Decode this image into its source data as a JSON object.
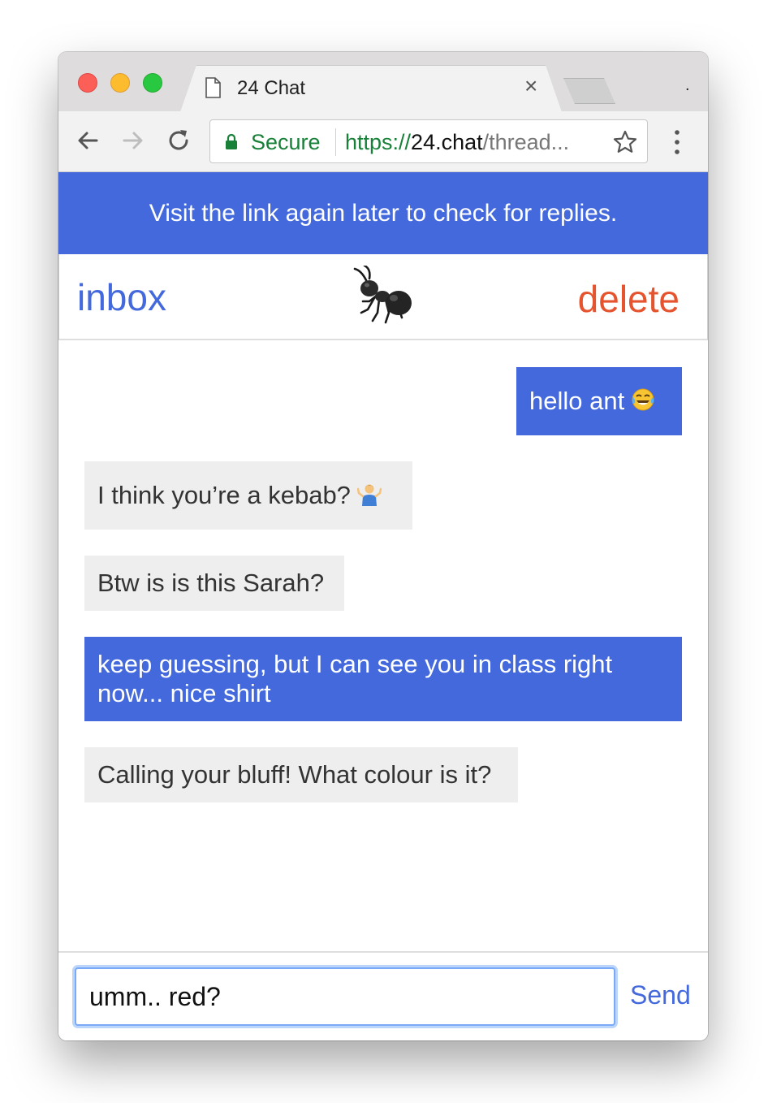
{
  "browser": {
    "tab_title": "24 Chat",
    "tab_close": "×",
    "strip_dot": ".",
    "secure_label": "Secure",
    "url_scheme": "https://",
    "url_host": "24.chat",
    "url_path": "/thread..."
  },
  "banner": {
    "text": "Visit the link again later to check for replies."
  },
  "header": {
    "inbox_label": "inbox",
    "avatar_icon": "ant-emoji-icon",
    "delete_label": "delete"
  },
  "messages": [
    {
      "direction": "sent",
      "text": "hello ant",
      "emoji": "tears-of-joy-emoji-icon"
    },
    {
      "direction": "received",
      "text": "I think you’re a kebab?",
      "emoji": "person-shrugging-emoji-icon"
    },
    {
      "direction": "received",
      "text": "Btw is is this Sarah?"
    },
    {
      "direction": "sent",
      "text": "keep guessing, but I can see you in class right now... nice shirt"
    },
    {
      "direction": "received",
      "text": "Calling your bluff! What colour is it?"
    }
  ],
  "composer": {
    "input_value": "umm.. red?",
    "send_label": "Send"
  },
  "colors": {
    "accent": "#4369dd",
    "delete": "#e5542e",
    "received_bubble": "#eeeeee",
    "secure_green": "#188038"
  }
}
